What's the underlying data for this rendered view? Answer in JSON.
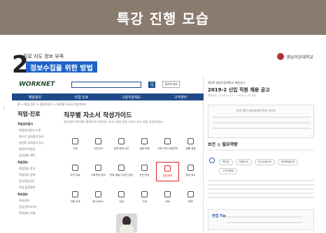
{
  "banner": {
    "title": "특강 진행 모습"
  },
  "slide": {
    "number": "2",
    "subtitle": "진로 지도 정보 부족",
    "title": "정보수집을 위한 방법",
    "univ_name": "영남이공대학교"
  },
  "worknet": {
    "logo": "WORKNET",
    "search_button": "Q",
    "search_extra": "알려주세요",
    "nav": [
      "채용정보",
      "직업·진로",
      "고용지원제도",
      "고객센터"
    ],
    "breadcrumb": "홈 > 직업·진로 > 직업가이드 > 직무별 자소서 작성가이드",
    "side_title": "직업·진로",
    "side_groups": [
      {
        "label": "직업심리검사",
        "items": [
          "직업심리검사 소개",
          "청소년 심리검사 실시",
          "성인용 심리검사 실시",
          "결과보기/상담",
          "검사결과 해석"
        ]
      },
      {
        "label": "직업정보",
        "items": [
          "직업정보 찾기",
          "직업정보 검색",
          "한국직업사전",
          "직업·훈련정보"
        ]
      },
      {
        "label": "학과정보",
        "items": [
          "학과검색",
          "전공진로가이드",
          "학과정보 이해"
        ]
      }
    ],
    "main_title": "직무별 자소서 작성가이드",
    "main_desc": "워크넷의 직무별로 올바르게 작성하는 자기소개서 작성 가이드 보고 취업 성공하세요~",
    "categories": [
      {
        "label": "전체",
        "selected": false
      },
      {
        "label": "사업관리",
        "selected": false
      },
      {
        "label": "경영·회계·사무",
        "selected": false
      },
      {
        "label": "금융·보험",
        "selected": false
      },
      {
        "label": "교육·자연·사회과학",
        "selected": false
      },
      {
        "label": "법률·경찰",
        "selected": false
      },
      {
        "label": "보건·의료",
        "selected": false
      },
      {
        "label": "사회복지·종교",
        "selected": false
      },
      {
        "label": "문화·예술·디자인·방송",
        "selected": false
      },
      {
        "label": "운전·운송",
        "selected": false
      },
      {
        "label": "영업판매",
        "selected": true
      },
      {
        "label": "경비·청소",
        "selected": false
      },
      {
        "label": "이용·숙박",
        "selected": false
      },
      {
        "label": "음식서비스",
        "selected": false
      },
      {
        "label": "건설",
        "selected": false
      },
      {
        "label": "기계",
        "selected": false
      },
      {
        "label": "재료",
        "selected": false
      },
      {
        "label": "화학",
        "selected": false
      }
    ]
  },
  "document": {
    "company": "2019 영남이공대학교 채용공고",
    "title": "2019-2 신입 직원 채용 공고",
    "date": "등록일자 : 2019.11.13 ~ 2019.11.25 마감",
    "box_heading": "보건 직무 자기소개서 작성 가이드",
    "section": "보건 ◎ 필요역량",
    "tags": [
      "책임감",
      "적응능력",
      "의사소통능력",
      "문제해결능력",
      "고객지향성"
    ],
    "tip": "면접 Tip"
  }
}
